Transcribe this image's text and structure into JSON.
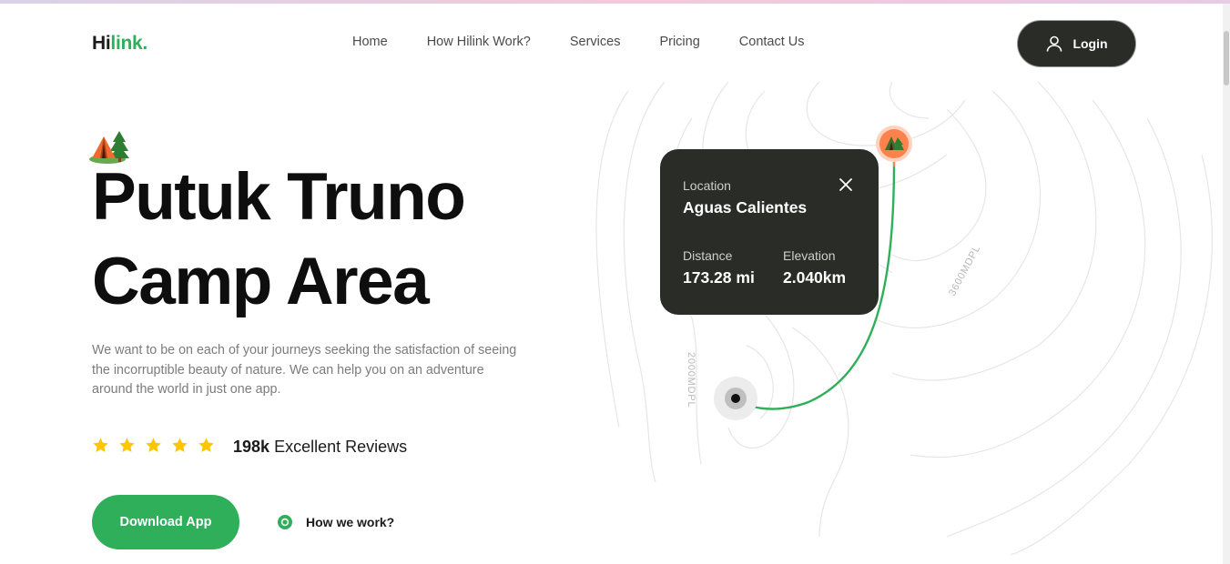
{
  "brand": {
    "part1": "Hi",
    "part2": "link."
  },
  "nav": [
    "Home",
    "How Hilink Work?",
    "Services",
    "Pricing",
    "Contact Us"
  ],
  "login": {
    "label": "Login",
    "icon": "user-icon"
  },
  "hero": {
    "title_line1": "Putuk Truno",
    "title_line2": "Camp Area",
    "description": "We want to be on each of your journeys seeking the satisfaction of seeing the incorruptible beauty of nature. We can help you on an adventure around the world in just one app.",
    "rating_stars": 5,
    "reviews_count": "198k",
    "reviews_label": "Excellent Reviews",
    "download_label": "Download App",
    "how_label": "How we work?"
  },
  "location_card": {
    "location_label": "Location",
    "location_value": "Aguas Calientes",
    "distance_label": "Distance",
    "distance_value": "173.28 mi",
    "elevation_label": "Elevation",
    "elevation_value": "2.040km"
  },
  "map": {
    "contour_label_1": "3600MDPL",
    "contour_label_2": "2000MDPL"
  },
  "colors": {
    "accent": "#30af5b",
    "dark": "#292c27",
    "star": "#fec601",
    "pin": "#ff814c"
  }
}
